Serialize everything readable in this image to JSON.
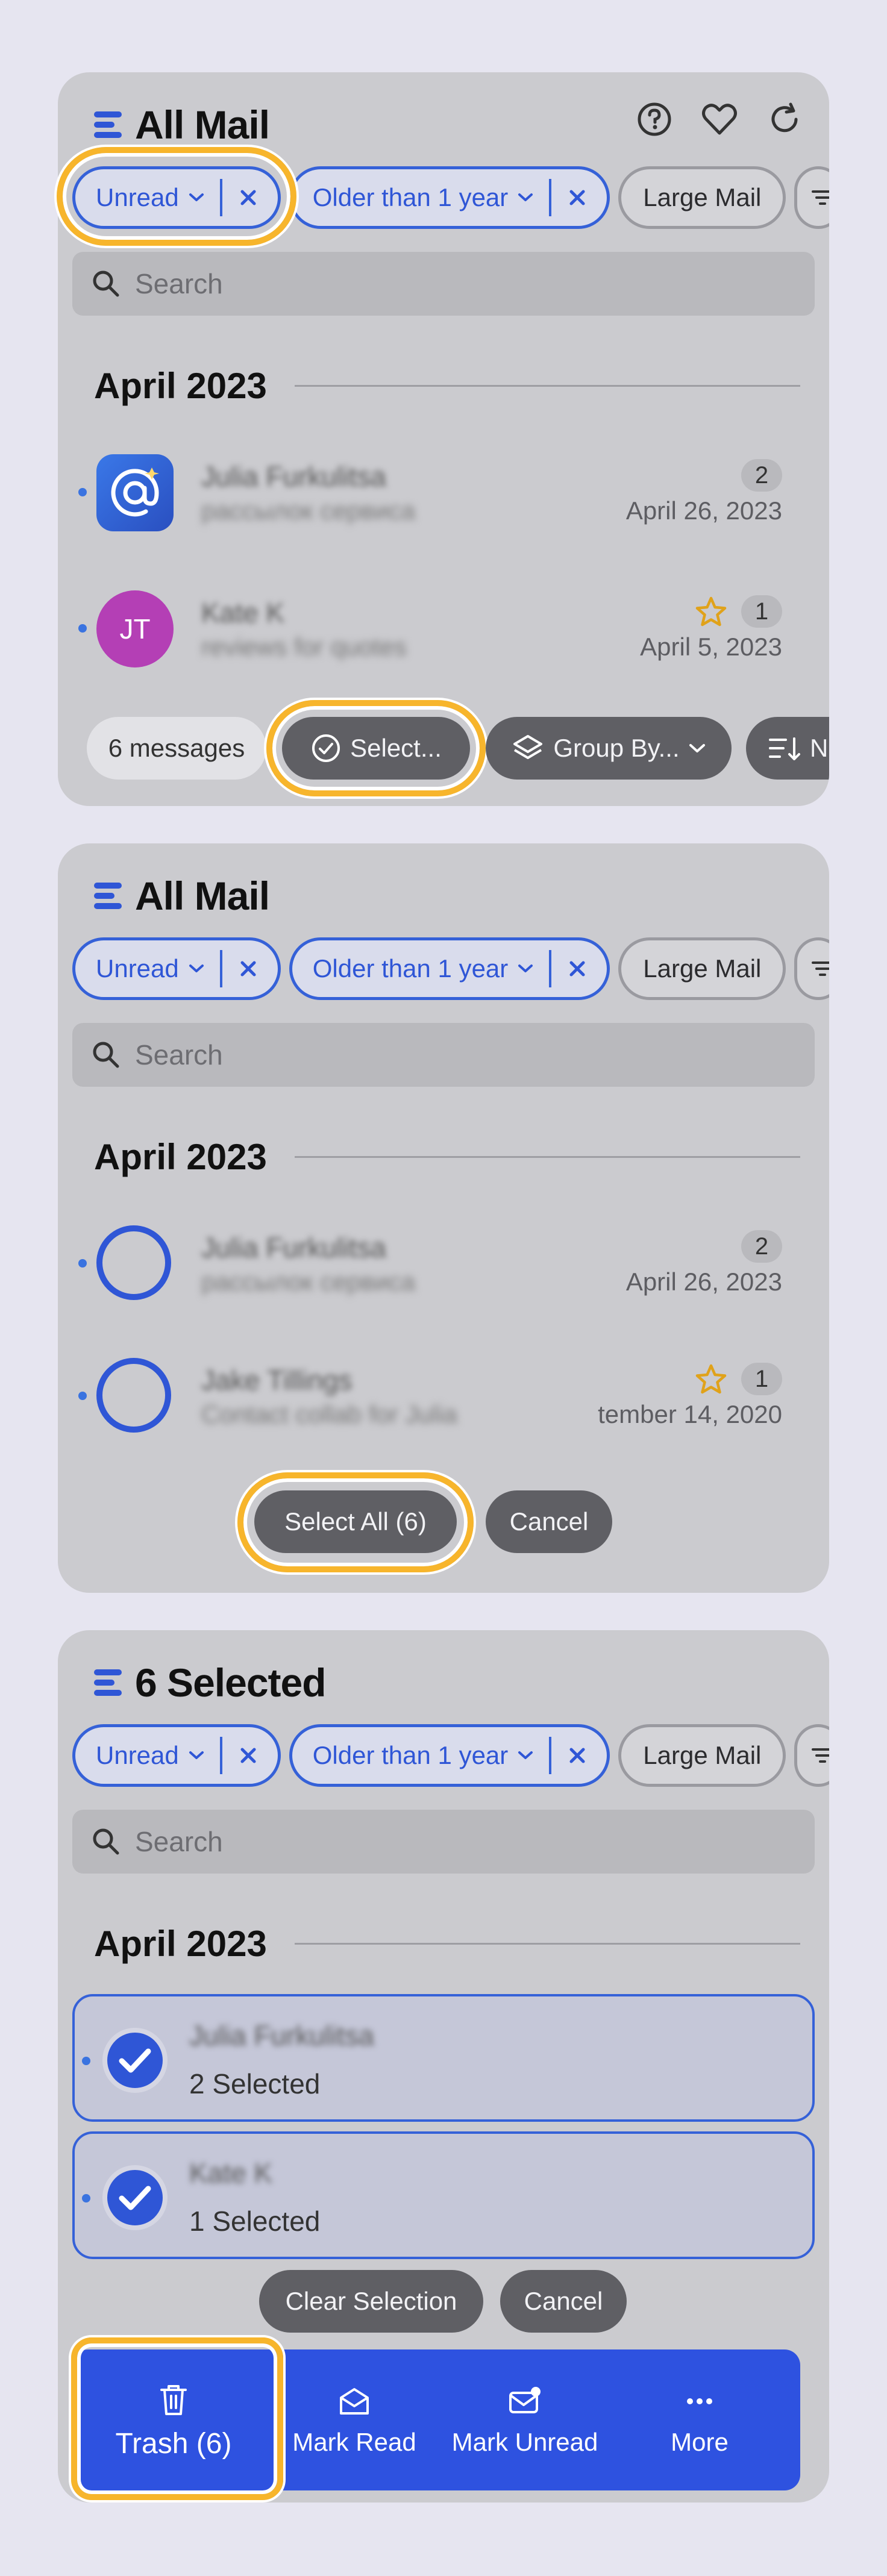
{
  "colors": {
    "accent": "#2f56d6",
    "highlight_ring": "#f7b52c",
    "panel": "#cbcbcf",
    "page_bg": "#e6e5f0",
    "star": "#e0a21a"
  },
  "filters": {
    "unread": "Unread",
    "older": "Older than 1 year",
    "large": "Large Mail"
  },
  "search": {
    "placeholder": "Search"
  },
  "section_label": "April 2023",
  "screen1": {
    "title": "All Mail",
    "header_icons": [
      "help-icon",
      "heart-icon",
      "refresh-icon"
    ],
    "rows": [
      {
        "sender": "Julia Furkulitsa",
        "snippet": "рассылок сервиса",
        "count": "2",
        "date": "April 26, 2023",
        "avatar": "@",
        "starred": false
      },
      {
        "sender": "Kate K",
        "snippet": "reviews for quotes",
        "count": "1",
        "date": "April 5, 2023",
        "avatar": "JT",
        "starred": true
      }
    ],
    "toolbar": {
      "messages": "6 messages",
      "select": "Select...",
      "group_by": "Group By...",
      "sort_partial": "N"
    }
  },
  "screen2": {
    "title": "All Mail",
    "rows": [
      {
        "sender": "Julia Furkulitsa",
        "snippet": "рассылок сервиса",
        "count": "2",
        "date": "April 26, 2023",
        "starred": false
      },
      {
        "sender": "Jake Tillings",
        "snippet": "Contact collab for Julia",
        "count": "1",
        "date": "tember 14, 2020",
        "starred": true
      }
    ],
    "select_all": "Select All (6)",
    "cancel": "Cancel"
  },
  "screen3": {
    "title": "6 Selected",
    "rows": [
      {
        "sender": "Julia Furkulitsa",
        "selected": "2 Selected"
      },
      {
        "sender": "Kate K",
        "selected": "1 Selected"
      }
    ],
    "clear_selection": "Clear Selection",
    "cancel": "Cancel",
    "actions": {
      "trash": "Trash (6)",
      "mark_read": "Mark Read",
      "mark_unread": "Mark Unread",
      "more": "More"
    }
  }
}
